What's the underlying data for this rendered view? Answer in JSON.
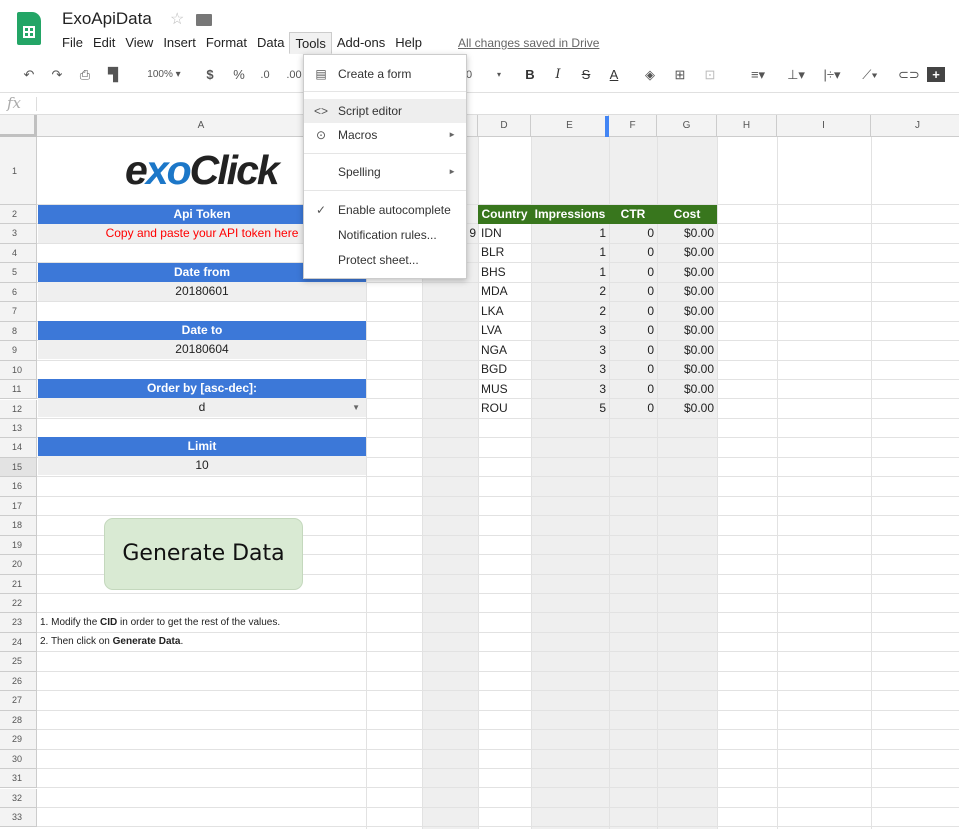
{
  "app": {
    "title": "ExoApiData",
    "saved_status": "All changes saved in Drive"
  },
  "menu": [
    "File",
    "Edit",
    "View",
    "Insert",
    "Format",
    "Data",
    "Tools",
    "Add-ons",
    "Help"
  ],
  "toolbar": {
    "zoom": "100%",
    "currency": "$",
    "percent": "%",
    "dec_less": ".0",
    "dec_more": ".00",
    "font_size_fragment": "0"
  },
  "formula_bar": {
    "fx": "fx"
  },
  "columns": [
    "A",
    "B",
    "C",
    "D",
    "E",
    "F",
    "G",
    "H",
    "I",
    "J"
  ],
  "rows": [
    "1",
    "2",
    "3",
    "4",
    "5",
    "6",
    "7",
    "8",
    "9",
    "10",
    "11",
    "12",
    "13",
    "14",
    "15",
    "16",
    "17",
    "18",
    "19",
    "20",
    "21",
    "22",
    "23",
    "24",
    "25",
    "26",
    "27",
    "28",
    "29",
    "30",
    "31",
    "32",
    "33"
  ],
  "sheet": {
    "logo_text": "exoClick",
    "logo_parts": {
      "a": "e",
      "b": "x",
      "c": "o",
      "d": "Click"
    },
    "api_token_label": "Api Token",
    "api_token_value": "Copy and paste your API token here",
    "date_from_label": "Date from",
    "date_from_value": "20180601",
    "date_to_label": "Date to",
    "date_to_value": "20180604",
    "order_label": "Order by [asc-dec]:",
    "order_value": "d",
    "limit_label": "Limit",
    "limit_value": "10",
    "generate_button": "Generate Data",
    "instruction_1_a": "1. Modify the ",
    "instruction_1_b": "CID",
    "instruction_1_c": " in order to get the rest of the values.",
    "instruction_2_a": "2. Then click on ",
    "instruction_2_b": "Generate Data",
    "instruction_2_c": ".",
    "c3_fragment": "9"
  },
  "table": {
    "headers": [
      "Country",
      "Impressions",
      "CTR",
      "Cost"
    ],
    "rows": [
      [
        "IDN",
        "1",
        "0",
        "$0.00"
      ],
      [
        "BLR",
        "1",
        "0",
        "$0.00"
      ],
      [
        "BHS",
        "1",
        "0",
        "$0.00"
      ],
      [
        "MDA",
        "2",
        "0",
        "$0.00"
      ],
      [
        "LKA",
        "2",
        "0",
        "$0.00"
      ],
      [
        "LVA",
        "3",
        "0",
        "$0.00"
      ],
      [
        "NGA",
        "3",
        "0",
        "$0.00"
      ],
      [
        "BGD",
        "3",
        "0",
        "$0.00"
      ],
      [
        "MUS",
        "3",
        "0",
        "$0.00"
      ],
      [
        "ROU",
        "5",
        "0",
        "$0.00"
      ]
    ]
  },
  "tools_menu": {
    "create_form": "Create a form",
    "script_editor": "Script editor",
    "macros": "Macros",
    "spelling": "Spelling",
    "enable_autocomplete": "Enable autocomplete",
    "notification_rules": "Notification rules...",
    "protect_sheet": "Protect sheet..."
  },
  "colors": {
    "blue_header": "#3c78d8",
    "green_header": "#38761d",
    "button_bg": "#d9ead3",
    "token_text": "#ff0000"
  }
}
